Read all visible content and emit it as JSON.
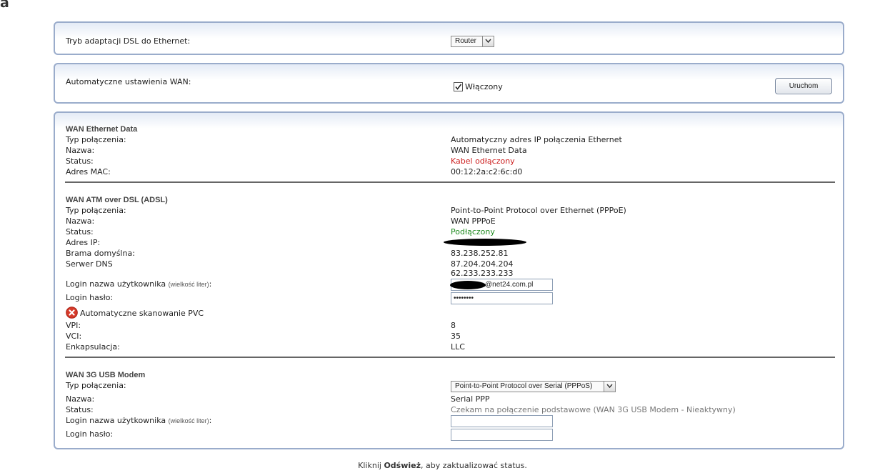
{
  "page": {
    "corner_title": "a"
  },
  "dsl_panel": {
    "label": "Tryb adaptacji DSL do Ethernet:",
    "select_value": "Router"
  },
  "wan_auto_panel": {
    "label": "Automatyczne ustawienia WAN:",
    "checkbox_label": "Włączony",
    "checkbox_checked": true,
    "run_button": "Uruchom"
  },
  "wan_ethernet": {
    "title": "WAN Ethernet Data",
    "rows": [
      {
        "label": "Typ połączenia:",
        "value": "Automatyczny adres IP połączenia Ethernet"
      },
      {
        "label": "Nazwa:",
        "value": "WAN Ethernet Data"
      },
      {
        "label": "Status:",
        "value": "Kabel odłączony",
        "status_color": "#cc1f1f"
      },
      {
        "label": "Adres MAC:",
        "value": "00:12:2a:c2:6c:d0"
      }
    ]
  },
  "wan_atm": {
    "title": "WAN ATM over DSL (ADSL)",
    "rows": [
      {
        "label": "Typ połączenia:",
        "value": "Point-to-Point Protocol over Ethernet (PPPoE)"
      },
      {
        "label": "Nazwa:",
        "value": "WAN PPPoE"
      },
      {
        "label": "Status:",
        "value": "Podłączony",
        "status_color": "#1f8a1f"
      },
      {
        "label": "Adres IP:",
        "value": ""
      },
      {
        "label": "Brama domyślna:",
        "value": "83.238.252.81"
      },
      {
        "label": "Serwer DNS",
        "value": "87.204.204.204",
        "value2": "62.233.233.233"
      }
    ],
    "login_user_label": "Login nazwa użytkownika",
    "login_user_hint": "(wielkość liter)",
    "login_user_colon": ":",
    "login_user_value": "@net24.com.pl",
    "login_pass_label": "Login hasło:",
    "login_pass_value": "••••••••",
    "pvc_scan_label": "Automatyczne skanowanie PVC",
    "pvc_icon": "red-x-circle-icon",
    "vpi_label": "VPI:",
    "vpi_value": "8",
    "vci_label": "VCI:",
    "vci_value": "35",
    "encap_label": "Enkapsulacja:",
    "encap_value": "LLC"
  },
  "wan_3g": {
    "title": "WAN 3G USB Modem",
    "type_label": "Typ połączenia:",
    "type_value": "Point-to-Point Protocol over Serial (PPPoS)",
    "name_label": "Nazwa:",
    "name_value": "Serial PPP",
    "status_label": "Status:",
    "status_value": "Czekam na połączenie podstawowe (WAN 3G USB Modem - Nieaktywny)",
    "login_user_label": "Login nazwa użytkownika",
    "login_user_hint": "(wielkość liter)",
    "login_user_colon": ":",
    "login_user_value": "",
    "login_pass_label": "Login hasło:",
    "login_pass_value": ""
  },
  "footer": {
    "prefix": "Kliknij ",
    "bold": "Odśwież",
    "suffix": ", aby zaktualizować status."
  },
  "colors": {
    "panel_border": "#9aaccb",
    "status_red": "#cc1f1f",
    "status_green": "#1f8a1f"
  }
}
